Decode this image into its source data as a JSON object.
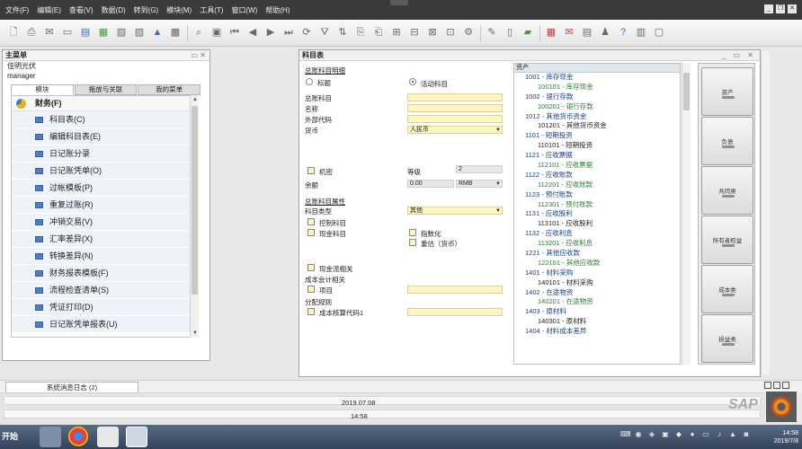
{
  "menubar": {
    "items": [
      "文件(F)",
      "编辑(E)",
      "查看(V)",
      "数据(D)",
      "转到(G)",
      "模块(M)",
      "工具(T)",
      "窗口(W)",
      "帮助(H)"
    ]
  },
  "main_menu": {
    "title": "主菜单",
    "user_name": "佳明光伏",
    "user_role": "manager",
    "tabs": [
      "模块",
      "拖放与关联",
      "我的菜单"
    ],
    "category": "财务(F)",
    "items": [
      "科目表(C)",
      "编辑科目表(E)",
      "日记账分录",
      "日记账凭单(O)",
      "过帐模板(P)",
      "重复过账(R)",
      "冲销交易(V)",
      "汇率差异(X)",
      "转换差异(N)",
      "财务报表模板(F)",
      "流程检查清单(S)",
      "凭证打印(D)",
      "日记账凭单报表(U)"
    ]
  },
  "coa": {
    "title": "科目表",
    "section_title": "总账科目明细",
    "radio_title": "标题",
    "radio_active": "活动科目",
    "labels": {
      "account_code": "总账科目",
      "name": "名称",
      "external_code": "外部代码",
      "currency": "货币",
      "confidential": "机密",
      "level": "等级",
      "balance": "余额",
      "props_title": "总账科目属性",
      "account_type": "科目类型",
      "control_account": "控制科目",
      "cash_account": "现金科目",
      "indexed": "指数化",
      "revaluation": "重估（货币）",
      "cash_flow": "现金流相关",
      "cost_accounting": "成本会计相关",
      "project": "项目",
      "distribution_rule": "分配规则",
      "cost_code": "成本核算代码1"
    },
    "values": {
      "currency": "人民币",
      "level": "2",
      "balance": "0.00",
      "balance_currency": "RMB",
      "account_type": "其他"
    },
    "tree_header": "资产",
    "tree": [
      {
        "level": 1,
        "text": "1001 - 库存现金"
      },
      {
        "level": 2,
        "text": "100101 - 库存现金"
      },
      {
        "level": 1,
        "text": "1002 - 银行存款"
      },
      {
        "level": 2,
        "text": "100201 - 银行存款"
      },
      {
        "level": 1,
        "text": "1012 - 其他货币资金"
      },
      {
        "level": 3,
        "text": "101201 - 其他货币资金"
      },
      {
        "level": 1,
        "text": "1101 - 短期投资"
      },
      {
        "level": 3,
        "text": "110101 - 短期投资"
      },
      {
        "level": 1,
        "text": "1121 - 应收票据"
      },
      {
        "level": 2,
        "text": "112101 - 应收票据"
      },
      {
        "level": 1,
        "text": "1122 - 应收账款"
      },
      {
        "level": 2,
        "text": "112201 - 应收账款"
      },
      {
        "level": 1,
        "text": "1123 - 预付账款"
      },
      {
        "level": 2,
        "text": "112301 - 预付账款"
      },
      {
        "level": 1,
        "text": "1131 - 应收股利"
      },
      {
        "level": 3,
        "text": "113101 - 应收股利"
      },
      {
        "level": 1,
        "text": "1132 - 应收利息"
      },
      {
        "level": 2,
        "text": "113201 - 应收利息"
      },
      {
        "level": 1,
        "text": "1221 - 其他应收款"
      },
      {
        "level": 2,
        "text": "122101 - 其他应收款"
      },
      {
        "level": 1,
        "text": "1401 - 材料采购"
      },
      {
        "level": 3,
        "text": "140101 - 材料采购"
      },
      {
        "level": 1,
        "text": "1402 - 在途物资"
      },
      {
        "level": 2,
        "text": "140201 - 在途物资"
      },
      {
        "level": 1,
        "text": "1403 - 原材料"
      },
      {
        "level": 3,
        "text": "140301 - 原材料"
      },
      {
        "level": 1,
        "text": "1404 - 材料成本差异"
      }
    ],
    "drawers": [
      "资产",
      "负债",
      "所有者权益",
      "共同类",
      "成本类",
      "损益类"
    ]
  },
  "status": {
    "message_tab": "系统消息日志 (2)",
    "date": "2019.07.08",
    "time": "14:58"
  },
  "brand": "SAP",
  "taskbar": {
    "start": "开始",
    "clock_time": "14:58",
    "clock_date": "2019/7/8"
  }
}
